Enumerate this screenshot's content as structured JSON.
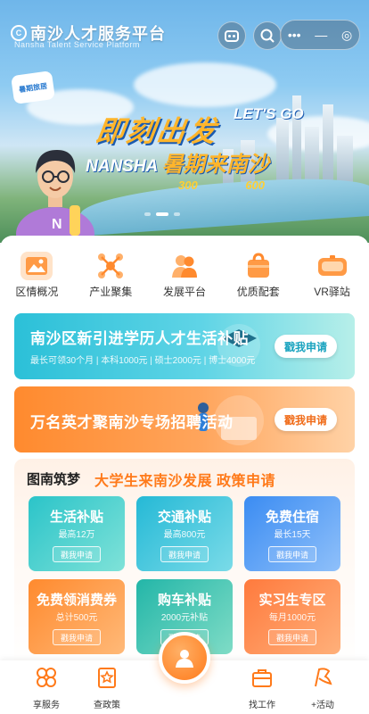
{
  "hero": {
    "logo_glyph": "C",
    "title": "南沙人才服务平台",
    "subtitle": "Nansha Talent Service Platform",
    "badge": "暑期旅居",
    "slogan": "即刻出发",
    "letsgo": "LET'S GO",
    "slogan2_prefix": "NANSHA",
    "slogan2_main": "暑期来南沙",
    "num1": "300",
    "num2": "600"
  },
  "capsule": {
    "more": "•••",
    "minimize": "—",
    "close": "◎"
  },
  "quick_links": [
    {
      "label": "区情概况",
      "icon": "landscape-icon",
      "color": "#ff8a2e"
    },
    {
      "label": "产业聚集",
      "icon": "network-icon",
      "color": "#ff8a2e"
    },
    {
      "label": "发展平台",
      "icon": "people-icon",
      "color": "#ff8a2e"
    },
    {
      "label": "优质配套",
      "icon": "bag-icon",
      "color": "#ff8a2e"
    },
    {
      "label": "VR驿站",
      "icon": "vr-icon",
      "color": "#ff8a2e"
    }
  ],
  "banner1": {
    "title": "南沙区新引进学历人才生活补贴",
    "subtitle": "最长可领30个月 | 本科1000元 | 硕士2000元 | 博士4000元",
    "button": "戳我申请"
  },
  "banner2": {
    "title": "万名英才聚南沙专场招聘活动",
    "button": "戳我申请"
  },
  "policy": {
    "heading": "图南筑梦",
    "heading2": "大学生来南沙发展 政策申请",
    "cards": [
      {
        "title": "生活补贴",
        "sub": "最高12万",
        "button": "戳我申请",
        "color1": "#2bc4c9",
        "color2": "#7fe2d8"
      },
      {
        "title": "交通补贴",
        "sub": "最高800元",
        "button": "戳我申请",
        "color1": "#25b9d6",
        "color2": "#7adbe8"
      },
      {
        "title": "免费住宿",
        "sub": "最长15天",
        "button": "戳我申请",
        "color1": "#3b8cf2",
        "color2": "#8fc0fa"
      },
      {
        "title": "免费领消费券",
        "sub": "总计500元",
        "button": "戳我申请",
        "color1": "#ff8a2e",
        "color2": "#ffb978"
      },
      {
        "title": "购车补贴",
        "sub": "2000元补贴",
        "button": "戳我申请",
        "color1": "#23b6a8",
        "color2": "#7fdcc6"
      },
      {
        "title": "实习生专区",
        "sub": "每月1000元",
        "button": "戳我申请",
        "color1": "#ff7a3d",
        "color2": "#ffb07a"
      }
    ]
  },
  "tabbar": {
    "items": [
      {
        "label": "享服务",
        "icon": "clover-icon"
      },
      {
        "label": "查政策",
        "icon": "policy-icon"
      },
      {
        "label": "找工作",
        "icon": "briefcase-icon"
      },
      {
        "label": "+活动",
        "icon": "activity-icon"
      }
    ],
    "center_icon": "user-service-icon"
  },
  "accent": "#ff7a1a"
}
